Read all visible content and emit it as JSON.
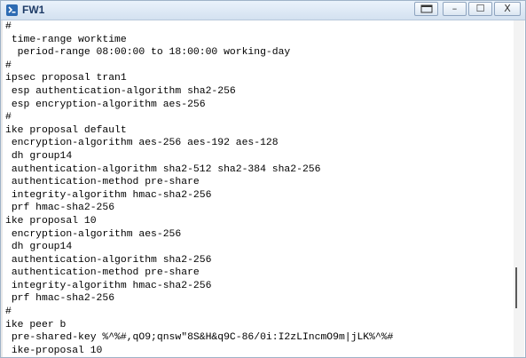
{
  "window": {
    "title": "FW1",
    "controls": {
      "extra": "",
      "minimize": "–",
      "maximize": "☐",
      "close": "X"
    }
  },
  "terminal": {
    "lines": [
      "#",
      " time-range worktime",
      "  period-range 08:00:00 to 18:00:00 working-day",
      "#",
      "ipsec proposal tran1",
      " esp authentication-algorithm sha2-256",
      " esp encryption-algorithm aes-256",
      "#",
      "ike proposal default",
      " encryption-algorithm aes-256 aes-192 aes-128",
      " dh group14",
      " authentication-algorithm sha2-512 sha2-384 sha2-256",
      " authentication-method pre-share",
      " integrity-algorithm hmac-sha2-256",
      " prf hmac-sha2-256",
      "ike proposal 10",
      " encryption-algorithm aes-256",
      " dh group14",
      " authentication-algorithm sha2-256",
      " authentication-method pre-share",
      " integrity-algorithm hmac-sha2-256",
      " prf hmac-sha2-256",
      "#",
      "ike peer b",
      " pre-shared-key %^%#,qO9;qnsw\"8S&H&q9C-86/0i:I2zLIncmO9m|jLK%^%#",
      " ike-proposal 10"
    ]
  },
  "icons": {
    "app": "terminal-app-icon",
    "extra": "restore-bar-icon"
  }
}
